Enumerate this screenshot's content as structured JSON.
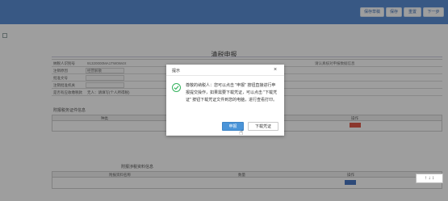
{
  "toolbar": {
    "btn1": "保存草稿",
    "btn2": "保存",
    "btn3": "重置",
    "btn4": "下一步"
  },
  "page": {
    "title": "清税申报"
  },
  "form": {
    "r1_label": "纳税人识别号",
    "r1_value": "91320000MA1TW0W4X",
    "r1_right": "请认真核对申报数据信息",
    "r2_label": "注销原因",
    "r2_value": "经营解散",
    "r3_label": "批准文号",
    "r4_label": "注销批准机关",
    "r5_label": "是否有应收缴税款",
    "r5_value": "无人：请填写(个人所得税)"
  },
  "sections": {
    "s1": "附报税务证件信息",
    "s2": "附报涉税资料信息"
  },
  "table1": {
    "col1": "种类",
    "col2": "数量",
    "col3": "操作"
  },
  "table2": {
    "col1": "附报资料名称",
    "col2": "数量",
    "col3": "操作"
  },
  "scroll_tools": "↑ ↓ ↕",
  "dialog": {
    "title": "提示",
    "close": "×",
    "message": "尊敬的纳税人：您可以点击 \"申报\" 按钮直接进行申报提交操作，如果需要下载凭证，可以点击 \"下载凭证\" 按钮下载凭证文件到您的电脑，进行查看打印。",
    "primary": "申报",
    "secondary": "下载凭证"
  },
  "colors": {
    "header": "#5b8ed6",
    "primary_button": "#4a94d8",
    "success": "#35b35e",
    "danger_button": "#e0594a"
  }
}
